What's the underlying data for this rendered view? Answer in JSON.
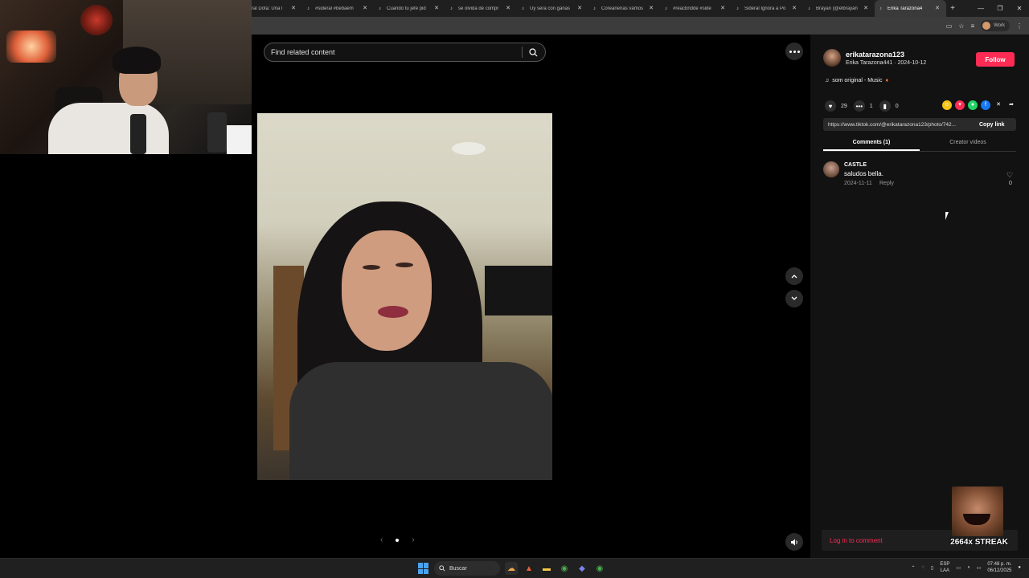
{
  "browser": {
    "tabs": [
      {
        "label": "ral Dota: Una l",
        "icon": "tiktok-icon",
        "active": false
      },
      {
        "label": "#sideral #bebaem",
        "icon": "tiktok-icon",
        "active": false
      },
      {
        "label": "Cuando tu jefe pid",
        "icon": "tiktok-icon",
        "active": false
      },
      {
        "label": "se olvida de compr",
        "icon": "tiktok-icon",
        "active": false
      },
      {
        "label": "Uy sera con ganas",
        "icon": "tiktok-icon",
        "active": false
      },
      {
        "label": "Coreanenas vamos",
        "icon": "tiktok-icon",
        "active": false
      },
      {
        "label": "#reacbridde #side",
        "icon": "tiktok-icon",
        "active": false
      },
      {
        "label": "Sideral Ignora a Po",
        "icon": "tiktok-icon",
        "active": false
      },
      {
        "label": "Brayan (@elbrayan",
        "icon": "tiktok-icon",
        "active": false
      },
      {
        "label": "Erika Tarazona4",
        "icon": "tiktok-icon",
        "active": true
      }
    ],
    "profile_name": "Work"
  },
  "viewer": {
    "search_placeholder": "Find related content",
    "page_indicator": {
      "current": 1,
      "total": 1
    }
  },
  "post": {
    "username": "erikatarazona123",
    "display_name_date": "Erika Tarazona441 · 2024-10-12",
    "follow_label": "Follow",
    "music": "som original - Music",
    "likes": "29",
    "comments": "1",
    "saves": "0",
    "url": "https://www.tiktok.com/@erikatarazona123/photo/742...",
    "copy_label": "Copy link"
  },
  "panel_tabs": [
    {
      "label": "Comments (1)",
      "active": true
    },
    {
      "label": "Creator videos",
      "active": false
    }
  ],
  "comments": [
    {
      "user": "CASTLE",
      "text": "saludos bella.",
      "date": "2024-11-11",
      "reply_label": "Reply",
      "likes": "0"
    }
  ],
  "login_prompt": "Log in to comment",
  "streak_label": "2664x STREAK",
  "taskbar": {
    "search_label": "Buscar",
    "lang_line1": "ESP",
    "lang_line2": "LAA",
    "time": "07:48 p. m.",
    "date": "06/12/2025"
  },
  "colors": {
    "accent": "#fe2c55",
    "panel_bg": "#121212",
    "viewer_bg": "#000000"
  }
}
